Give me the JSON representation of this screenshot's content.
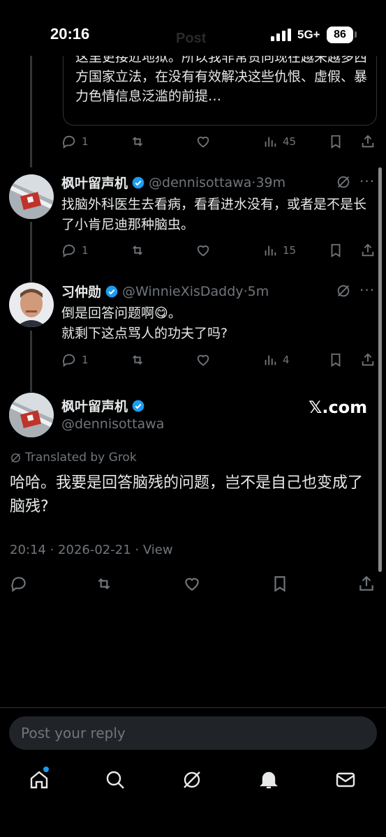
{
  "status_bar": {
    "time": "20:16",
    "network": "5G+",
    "battery": "86",
    "faded_title": "Post"
  },
  "quote": {
    "text": "这里更接近地狱。所以我非常赞同现在越来越多西方国家立法，在没有有效解决这些仇恨、虚假、暴力色情信息泛滥的前提…"
  },
  "quote_actions": {
    "replies": "1",
    "views": "45"
  },
  "tweets": [
    {
      "name": "枫叶留声机",
      "handle": "@dennisottawa",
      "time": "39m",
      "text": "找脑外科医生去看病，看看进水没有，或者是不是长了小肯尼迪那种脑虫。",
      "replies": "1",
      "views": "15"
    },
    {
      "name": "习仲勋",
      "handle": "@WinnieXisDaddy",
      "time": "5m",
      "text_line1": "倒是回答问题啊",
      "emoji": "😋",
      "text_line1_end": "。",
      "text_line2": "就剩下这点骂人的功夫了吗?",
      "replies": "1",
      "views": "4"
    }
  ],
  "main_tweet": {
    "name": "枫叶留声机",
    "handle": "@dennisottawa",
    "watermark": "𝕏.com",
    "translated_label": "Translated by Grok",
    "text": "哈哈。我要是回答脑残的问题，岂不是自己也变成了脑残?",
    "time": "20:14",
    "date": "2026-02-21",
    "view_label": "View"
  },
  "reply_box": {
    "placeholder": "Post your reply"
  },
  "separator": " · ",
  "more_glyph": "···",
  "colors": {
    "accent": "#1d9bf0",
    "background": "#000000",
    "muted": "#71767b",
    "text": "#e7e9ea"
  },
  "icons": [
    "reply-icon",
    "repost-icon",
    "like-icon",
    "views-icon",
    "bookmark-icon",
    "share-icon",
    "grok-icon",
    "more-icon",
    "verified-icon",
    "home-icon",
    "search-icon",
    "notifications-icon",
    "messages-icon"
  ]
}
